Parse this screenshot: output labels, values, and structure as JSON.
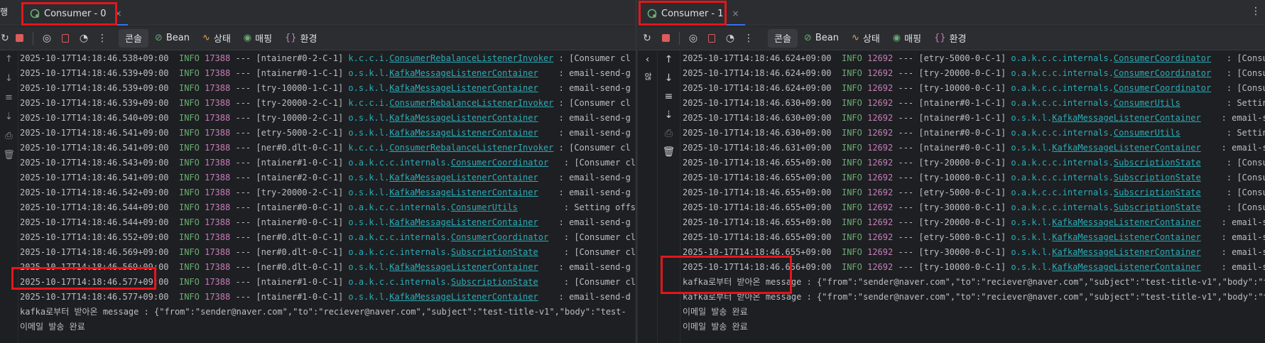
{
  "left": {
    "edge_label": "행",
    "tab_title": "Consumer - 0",
    "tab_close": "×",
    "view_tabs": [
      {
        "label": "콘솔",
        "icon": ""
      },
      {
        "label": "Bean",
        "icon": "⊘"
      },
      {
        "label": "상태",
        "icon": "∿"
      },
      {
        "label": "매핑",
        "icon": "◉"
      },
      {
        "label": "환경",
        "icon": "{}"
      }
    ],
    "log_lines": [
      {
        "ts": "2025-10-17T14:18:46.538+09:00",
        "lvl": "INFO",
        "pid": "17388",
        "thread": "--- [ntainer#0-2-C-1]",
        "logger_prefix": "k.c.c.i.",
        "logger_class": "ConsumerRebalanceListenerInvoker",
        "msg": ": [Consumer cl"
      },
      {
        "ts": "2025-10-17T14:18:46.539+09:00",
        "lvl": "INFO",
        "pid": "17388",
        "thread": "--- [ntainer#0-1-C-1]",
        "logger_prefix": "o.s.k.l.",
        "logger_class": "KafkaMessageListenerContainer",
        "msg": "   : email-send-g"
      },
      {
        "ts": "2025-10-17T14:18:46.539+09:00",
        "lvl": "INFO",
        "pid": "17388",
        "thread": "--- [try-10000-1-C-1]",
        "logger_prefix": "o.s.k.l.",
        "logger_class": "KafkaMessageListenerContainer",
        "msg": "   : email-send-g"
      },
      {
        "ts": "2025-10-17T14:18:46.539+09:00",
        "lvl": "INFO",
        "pid": "17388",
        "thread": "--- [try-20000-2-C-1]",
        "logger_prefix": "k.c.c.i.",
        "logger_class": "ConsumerRebalanceListenerInvoker",
        "msg": ": [Consumer cl"
      },
      {
        "ts": "2025-10-17T14:18:46.540+09:00",
        "lvl": "INFO",
        "pid": "17388",
        "thread": "--- [try-10000-2-C-1]",
        "logger_prefix": "o.s.k.l.",
        "logger_class": "KafkaMessageListenerContainer",
        "msg": "   : email-send-g"
      },
      {
        "ts": "2025-10-17T14:18:46.541+09:00",
        "lvl": "INFO",
        "pid": "17388",
        "thread": "--- [etry-5000-2-C-1]",
        "logger_prefix": "o.s.k.l.",
        "logger_class": "KafkaMessageListenerContainer",
        "msg": "   : email-send-g"
      },
      {
        "ts": "2025-10-17T14:18:46.541+09:00",
        "lvl": "INFO",
        "pid": "17388",
        "thread": "--- [ner#0.dlt-0-C-1]",
        "logger_prefix": "k.c.c.i.",
        "logger_class": "ConsumerRebalanceListenerInvoker",
        "msg": ": [Consumer cl"
      },
      {
        "ts": "2025-10-17T14:18:46.543+09:00",
        "lvl": "INFO",
        "pid": "17388",
        "thread": "--- [ntainer#1-0-C-1]",
        "logger_prefix": "o.a.k.c.c.internals.",
        "logger_class": "ConsumerCoordinator",
        "msg": "  : [Consumer cl"
      },
      {
        "ts": "2025-10-17T14:18:46.541+09:00",
        "lvl": "INFO",
        "pid": "17388",
        "thread": "--- [ntainer#2-0-C-1]",
        "logger_prefix": "o.s.k.l.",
        "logger_class": "KafkaMessageListenerContainer",
        "msg": "   : email-send-g"
      },
      {
        "ts": "2025-10-17T14:18:46.542+09:00",
        "lvl": "INFO",
        "pid": "17388",
        "thread": "--- [try-20000-2-C-1]",
        "logger_prefix": "o.s.k.l.",
        "logger_class": "KafkaMessageListenerContainer",
        "msg": "   : email-send-g"
      },
      {
        "ts": "2025-10-17T14:18:46.544+09:00",
        "lvl": "INFO",
        "pid": "17388",
        "thread": "--- [ntainer#0-0-C-1]",
        "logger_prefix": "o.a.k.c.c.internals.",
        "logger_class": "ConsumerUtils",
        "msg": "        : Setting offs"
      },
      {
        "ts": "2025-10-17T14:18:46.544+09:00",
        "lvl": "INFO",
        "pid": "17388",
        "thread": "--- [ntainer#0-0-C-1]",
        "logger_prefix": "o.s.k.l.",
        "logger_class": "KafkaMessageListenerContainer",
        "msg": "   : email-send-g"
      },
      {
        "ts": "2025-10-17T14:18:46.552+09:00",
        "lvl": "INFO",
        "pid": "17388",
        "thread": "--- [ner#0.dlt-0-C-1]",
        "logger_prefix": "o.a.k.c.c.internals.",
        "logger_class": "ConsumerCoordinator",
        "msg": "  : [Consumer cl"
      },
      {
        "ts": "2025-10-17T14:18:46.569+09:00",
        "lvl": "INFO",
        "pid": "17388",
        "thread": "--- [ner#0.dlt-0-C-1]",
        "logger_prefix": "o.a.k.c.c.internals.",
        "logger_class": "SubscriptionState",
        "msg": "    : [Consumer cl"
      },
      {
        "ts": "2025-10-17T14:18:46.569+09:00",
        "lvl": "INFO",
        "pid": "17388",
        "thread": "--- [ner#0.dlt-0-C-1]",
        "logger_prefix": "o.s.k.l.",
        "logger_class": "KafkaMessageListenerContainer",
        "msg": "   : email-send-g"
      },
      {
        "ts": "2025-10-17T14:18:46.577+09:00",
        "lvl": "INFO",
        "pid": "17388",
        "thread": "--- [ntainer#1-0-C-1]",
        "logger_prefix": "o.a.k.c.c.internals.",
        "logger_class": "SubscriptionState",
        "msg": "    : [Consumer cl"
      },
      {
        "ts": "2025-10-17T14:18:46.577+09:00",
        "lvl": "INFO",
        "pid": "17388",
        "thread": "--- [ntainer#1-0-C-1]",
        "logger_prefix": "o.s.k.l.",
        "logger_class": "KafkaMessageListenerContainer",
        "msg": "   : email-send-d"
      }
    ],
    "message_lines": [
      "kafka로부터 받아온 message : {\"from\":\"sender@naver.com\",\"to\":\"reciever@naver.com\",\"subject\":\"test-title-v1\",\"body\":\"test-",
      "이메일 발송 완료"
    ]
  },
  "right": {
    "tab_title": "Consumer - 1",
    "tab_close": "×",
    "collapse_label": "‹",
    "side_label": "않",
    "view_tabs": [
      {
        "label": "콘솔",
        "icon": ""
      },
      {
        "label": "Bean",
        "icon": "⊘"
      },
      {
        "label": "상태",
        "icon": "∿"
      },
      {
        "label": "매핑",
        "icon": "◉"
      },
      {
        "label": "환경",
        "icon": "{}"
      }
    ],
    "log_lines": [
      {
        "ts": "2025-10-17T14:18:46.624+09:00",
        "lvl": "INFO",
        "pid": "12692",
        "thread": "--- [etry-5000-0-C-1]",
        "logger_prefix": "o.a.k.c.c.internals.",
        "logger_class": "ConsumerCoordinator",
        "msg": "  : [Consumer cl"
      },
      {
        "ts": "2025-10-17T14:18:46.624+09:00",
        "lvl": "INFO",
        "pid": "12692",
        "thread": "--- [try-20000-0-C-1]",
        "logger_prefix": "o.a.k.c.c.internals.",
        "logger_class": "ConsumerCoordinator",
        "msg": "  : [Consumer cl"
      },
      {
        "ts": "2025-10-17T14:18:46.624+09:00",
        "lvl": "INFO",
        "pid": "12692",
        "thread": "--- [try-10000-0-C-1]",
        "logger_prefix": "o.a.k.c.c.internals.",
        "logger_class": "ConsumerCoordinator",
        "msg": "  : [Consumer cl"
      },
      {
        "ts": "2025-10-17T14:18:46.630+09:00",
        "lvl": "INFO",
        "pid": "12692",
        "thread": "--- [ntainer#0-1-C-1]",
        "logger_prefix": "o.a.k.c.c.internals.",
        "logger_class": "ConsumerUtils",
        "msg": "        : Setting offs"
      },
      {
        "ts": "2025-10-17T14:18:46.630+09:00",
        "lvl": "INFO",
        "pid": "12692",
        "thread": "--- [ntainer#0-1-C-1]",
        "logger_prefix": "o.s.k.l.",
        "logger_class": "KafkaMessageListenerContainer",
        "msg": "   : email-send-g"
      },
      {
        "ts": "2025-10-17T14:18:46.630+09:00",
        "lvl": "INFO",
        "pid": "12692",
        "thread": "--- [ntainer#0-0-C-1]",
        "logger_prefix": "o.a.k.c.c.internals.",
        "logger_class": "ConsumerUtils",
        "msg": "        : Setting offs"
      },
      {
        "ts": "2025-10-17T14:18:46.631+09:00",
        "lvl": "INFO",
        "pid": "12692",
        "thread": "--- [ntainer#0-0-C-1]",
        "logger_prefix": "o.s.k.l.",
        "logger_class": "KafkaMessageListenerContainer",
        "msg": "   : email-send-g"
      },
      {
        "ts": "2025-10-17T14:18:46.655+09:00",
        "lvl": "INFO",
        "pid": "12692",
        "thread": "--- [try-20000-0-C-1]",
        "logger_prefix": "o.a.k.c.c.internals.",
        "logger_class": "SubscriptionState",
        "msg": "    : [Consumer cl"
      },
      {
        "ts": "2025-10-17T14:18:46.655+09:00",
        "lvl": "INFO",
        "pid": "12692",
        "thread": "--- [try-10000-0-C-1]",
        "logger_prefix": "o.a.k.c.c.internals.",
        "logger_class": "SubscriptionState",
        "msg": "    : [Consumer cl"
      },
      {
        "ts": "2025-10-17T14:18:46.655+09:00",
        "lvl": "INFO",
        "pid": "12692",
        "thread": "--- [etry-5000-0-C-1]",
        "logger_prefix": "o.a.k.c.c.internals.",
        "logger_class": "SubscriptionState",
        "msg": "    : [Consumer cl"
      },
      {
        "ts": "2025-10-17T14:18:46.655+09:00",
        "lvl": "INFO",
        "pid": "12692",
        "thread": "--- [try-30000-0-C-1]",
        "logger_prefix": "o.a.k.c.c.internals.",
        "logger_class": "SubscriptionState",
        "msg": "    : [Consumer cl"
      },
      {
        "ts": "2025-10-17T14:18:46.655+09:00",
        "lvl": "INFO",
        "pid": "12692",
        "thread": "--- [try-20000-0-C-1]",
        "logger_prefix": "o.s.k.l.",
        "logger_class": "KafkaMessageListenerContainer",
        "msg": "   : email-send-g"
      },
      {
        "ts": "2025-10-17T14:18:46.655+09:00",
        "lvl": "INFO",
        "pid": "12692",
        "thread": "--- [etry-5000-0-C-1]",
        "logger_prefix": "o.s.k.l.",
        "logger_class": "KafkaMessageListenerContainer",
        "msg": "   : email-send-g"
      },
      {
        "ts": "2025-10-17T14:18:46.655+09:00",
        "lvl": "INFO",
        "pid": "12692",
        "thread": "--- [try-30000-0-C-1]",
        "logger_prefix": "o.s.k.l.",
        "logger_class": "KafkaMessageListenerContainer",
        "msg": "   : email-send-g"
      },
      {
        "ts": "2025-10-17T14:18:46.656+09:00",
        "lvl": "INFO",
        "pid": "12692",
        "thread": "--- [try-10000-0-C-1]",
        "logger_prefix": "o.s.k.l.",
        "logger_class": "KafkaMessageListenerContainer",
        "msg": "   : email-send-g"
      }
    ],
    "message_lines": [
      "kafka로부터 받아온 message : {\"from\":\"sender@naver.com\",\"to\":\"reciever@naver.com\",\"subject\":\"test-title-v1\",\"body\":\"test-",
      "kafka로부터 받아온 message : {\"from\":\"sender@naver.com\",\"to\":\"reciever@naver.com\",\"subject\":\"test-title-v1\",\"body\":\"test-",
      "이메일 발송 완료",
      "이메일 발송 완료"
    ]
  },
  "colors": {
    "background": "#1e1f22",
    "toolbar": "#2b2d30",
    "info": "#6aab73",
    "pid": "#c77dbb",
    "logger": "#2aacb8",
    "highlight": "#e3161c"
  }
}
